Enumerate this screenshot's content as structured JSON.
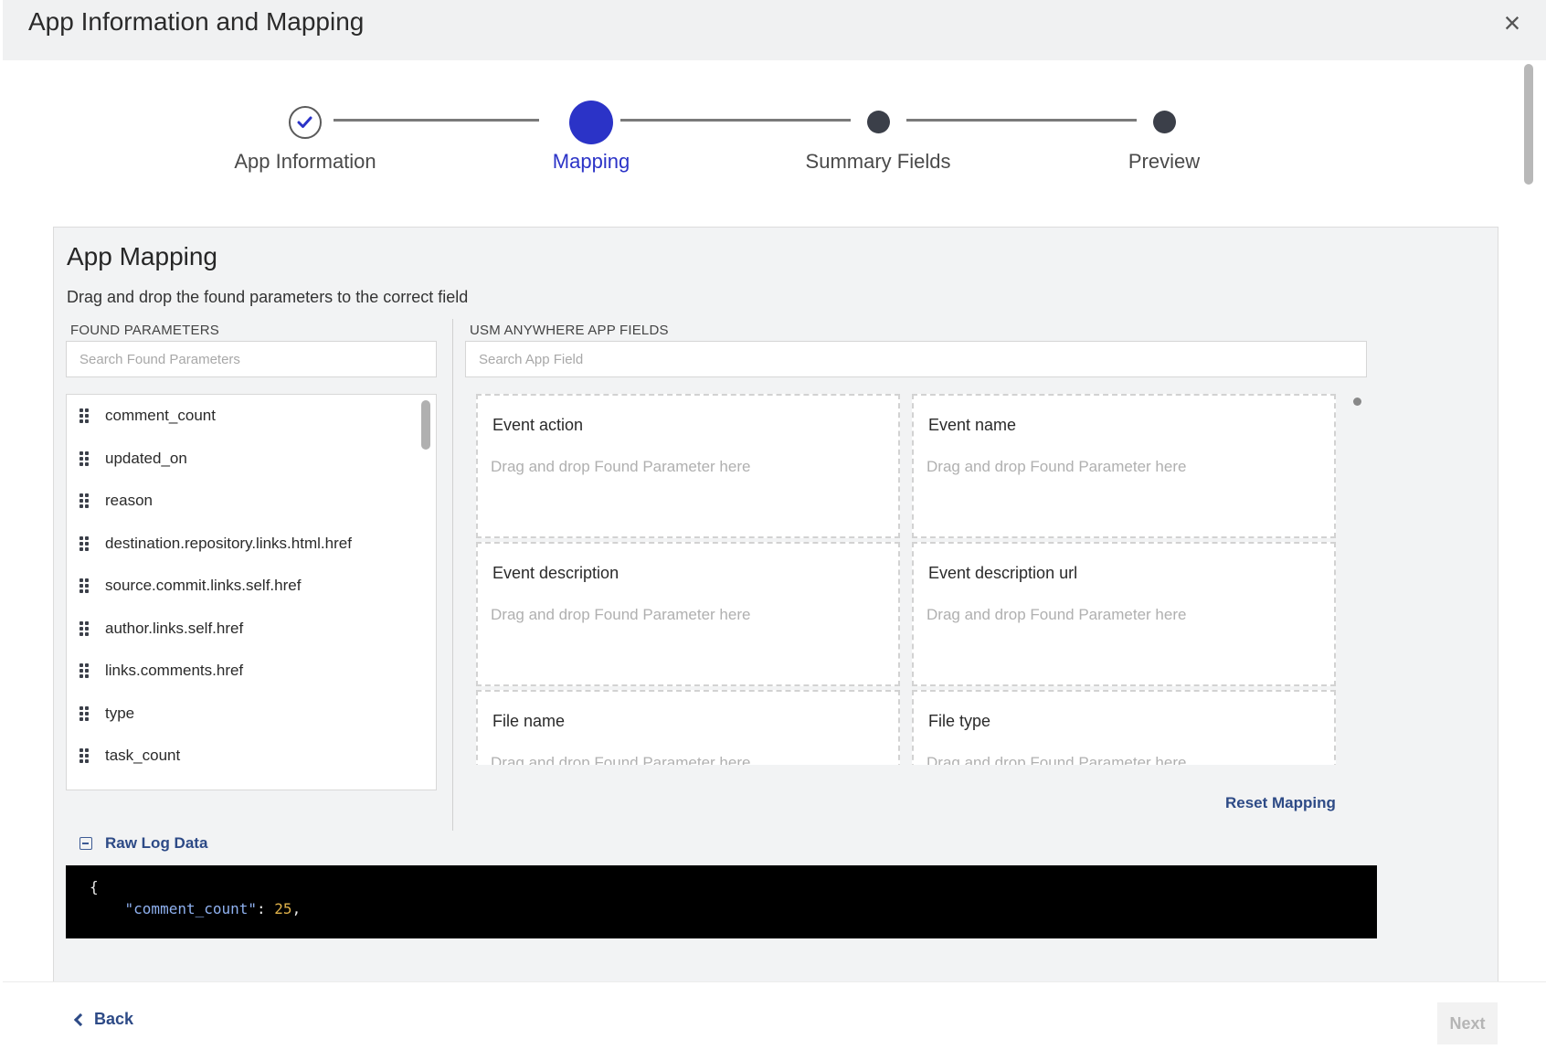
{
  "modal": {
    "title": "App Information and Mapping",
    "close_symbol": "×"
  },
  "stepper": {
    "steps": [
      {
        "label": "App Information",
        "state": "completed",
        "icon": "check-icon"
      },
      {
        "label": "Mapping",
        "state": "active"
      },
      {
        "label": "Summary Fields",
        "state": "pending"
      },
      {
        "label": "Preview",
        "state": "pending"
      }
    ],
    "active_color": "#2b33c7"
  },
  "panel": {
    "title": "App Mapping",
    "subtitle": "Drag and drop the found parameters to the correct field",
    "found_label": "FOUND PARAMETERS",
    "found_search_placeholder": "Search Found Parameters",
    "fields_label": "USM ANYWHERE APP FIELDS",
    "fields_search_placeholder": "Search App Field",
    "parameters": [
      "comment_count",
      "updated_on",
      "reason",
      "destination.repository.links.html.href",
      "source.commit.links.self.href",
      "author.links.self.href",
      "links.comments.href",
      "type",
      "task_count"
    ],
    "drop_hint": "Drag and drop Found Parameter here",
    "app_fields": [
      "Event action",
      "Event name",
      "Event description",
      "Event description url",
      "File name",
      "File type"
    ],
    "reset_label": "Reset Mapping",
    "raw_label": "Raw Log Data",
    "raw_lines": [
      {
        "open": "{"
      },
      {
        "key": "\"comment_count\"",
        "sep": ": ",
        "value": "25",
        "end": ","
      }
    ]
  },
  "footer": {
    "back_label": "Back",
    "next_label": "Next"
  }
}
